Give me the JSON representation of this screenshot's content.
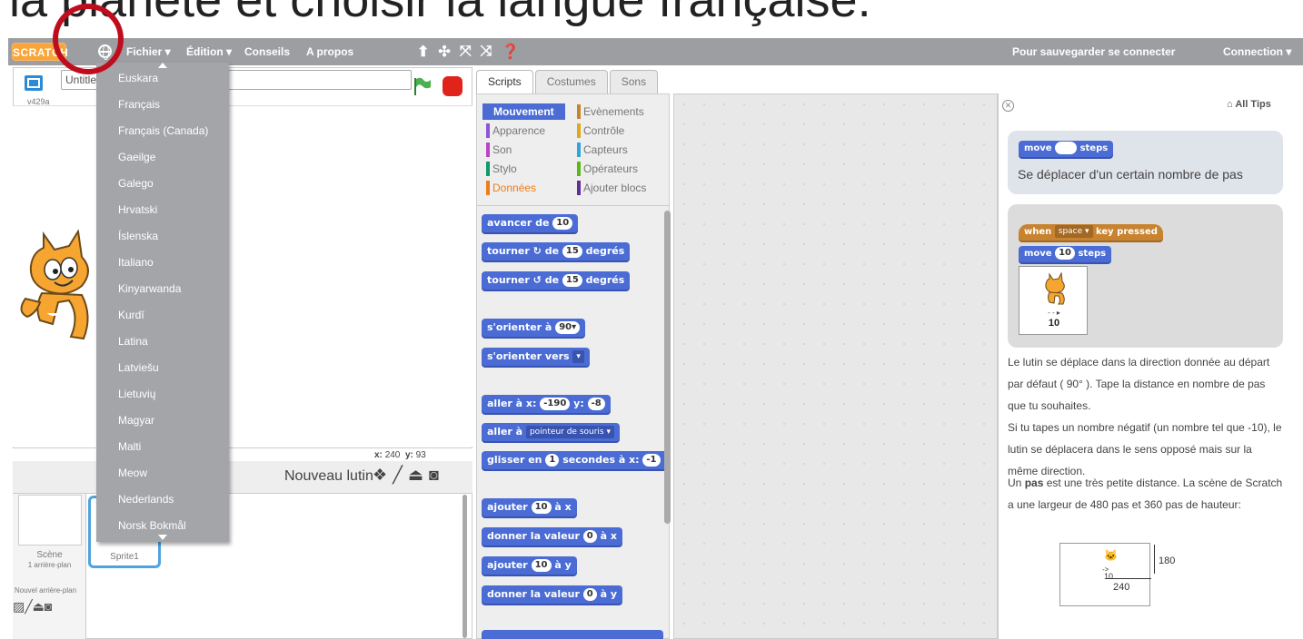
{
  "caption": "la planète et choisir la langue française.",
  "menubar": {
    "logo": "SCRATCH",
    "file": "Fichier ▾",
    "edit": "Édition ▾",
    "tips": "Conseils",
    "about": "A propos",
    "save_prompt": "Pour sauvegarder se connecter",
    "connect": "Connection ▾"
  },
  "stage": {
    "title_value": "Untitled",
    "version": "v429a",
    "coords_x_label": "x:",
    "coords_x": "240",
    "coords_y_label": "y:",
    "coords_y": "93"
  },
  "sprites": {
    "new_sprite": "Nouveau lutin",
    "scene_label": "Scène",
    "scene_sub": "1 arrière-plan",
    "new_backdrop": "Nouvel arrière-plan",
    "sprite1": "Sprite1"
  },
  "tabs": [
    "Scripts",
    "Costumes",
    "Sons"
  ],
  "categories": {
    "mouvement": "Mouvement",
    "evenements": "Evènements",
    "apparence": "Apparence",
    "controle": "Contrôle",
    "son": "Son",
    "capteurs": "Capteurs",
    "stylo": "Stylo",
    "operateurs": "Opérateurs",
    "donnees": "Données",
    "ajouter": "Ajouter blocs"
  },
  "blocks": {
    "b1_a": "avancer de",
    "b1_v": "10",
    "b2_a": "tourner",
    "b2_b": "de",
    "b2_v": "15",
    "b2_c": "degrés",
    "b3_a": "tourner",
    "b3_b": "de",
    "b3_v": "15",
    "b3_c": "degrés",
    "b4_a": "s'orienter à",
    "b4_v": "90▾",
    "b5_a": "s'orienter vers",
    "b5_v": "▾",
    "b6_a": "aller à x:",
    "b6_v1": "-190",
    "b6_b": "y:",
    "b6_v2": "-8",
    "b7_a": "aller à",
    "b7_v": "pointeur de souris ▾",
    "b8_a": "glisser en",
    "b8_v1": "1",
    "b8_b": "secondes à x:",
    "b8_v2": "-1",
    "b9_a": "ajouter",
    "b9_v": "10",
    "b9_b": "à x",
    "b10_a": "donner la valeur",
    "b10_v": "0",
    "b10_b": "à x",
    "b11_a": "ajouter",
    "b11_v": "10",
    "b11_b": "à y",
    "b12_a": "donner la valeur",
    "b12_v": "0",
    "b12_b": "à y"
  },
  "tips": {
    "all_tips": "All Tips",
    "card1_block": "move",
    "card1_block_end": "steps",
    "card1_text": "Se déplacer d'un certain nombre de pas",
    "card2_when": "when",
    "card2_key": "space ▾",
    "card2_key_end": "key pressed",
    "card2_move": "move",
    "card2_move_v": "10",
    "card2_move_end": "steps",
    "card2_img_num": "10",
    "p1": "Le lutin se déplace dans la direction donnée au départ par défaut ( 90° ). Tape la distance en nombre de pas que tu souhaites.",
    "p2": "Si tu tapes un nombre négatif (un nombre tel que -10), le lutin se déplacera dans le sens opposé mais sur la même direction.",
    "p3_a": "Un ",
    "p3_b": "pas",
    "p3_c": " est une très petite distance. La scène de Scratch a une largeur de 480 pas et 360 pas de hauteur:",
    "diagram_h": "180",
    "diagram_w": "240",
    "diagram_step": "10"
  },
  "languages": [
    "Euskara",
    "Français",
    "Français (Canada)",
    "Gaeilge",
    "Galego",
    "Hrvatski",
    "Íslenska",
    "Italiano",
    "Kinyarwanda",
    "Kurdî",
    "Latina",
    "Latviešu",
    "Lietuvių",
    "Magyar",
    "Malti",
    "Meow",
    "Nederlands",
    "Norsk Bokmål"
  ],
  "colors": {
    "menubar": "#9c9ea2",
    "motion": "#4a6cd4",
    "events": "#c88330",
    "highlight_circle": "#c00d1e"
  }
}
